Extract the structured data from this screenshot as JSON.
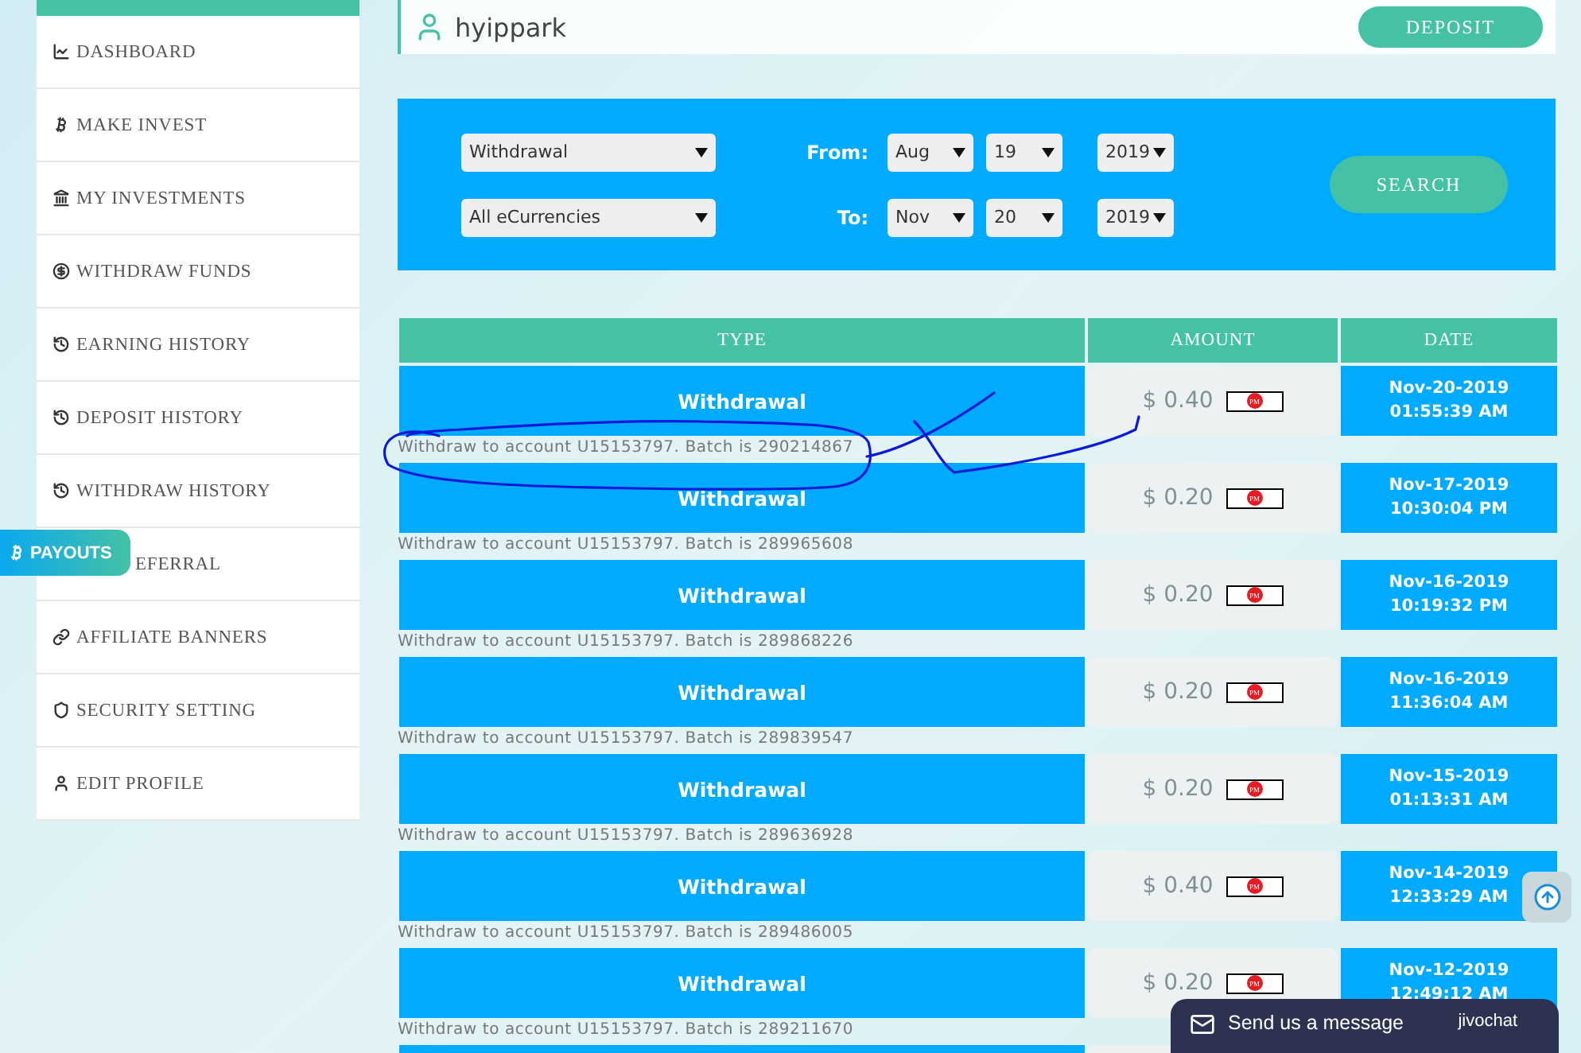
{
  "header": {
    "username": "hyippark",
    "button": "DEPOSIT"
  },
  "sidebar": {
    "items": [
      {
        "label": "DASHBOARD"
      },
      {
        "label": "MAKE INVEST"
      },
      {
        "label": "MY INVESTMENTS"
      },
      {
        "label": "WITHDRAW FUNDS"
      },
      {
        "label": "EARNING HISTORY"
      },
      {
        "label": "DEPOSIT HISTORY"
      },
      {
        "label": "WITHDRAW HISTORY"
      },
      {
        "label": "EFERRAL"
      },
      {
        "label": "AFFILIATE BANNERS"
      },
      {
        "label": "SECURITY SETTING"
      },
      {
        "label": "EDIT PROFILE"
      }
    ]
  },
  "payouts_tab": {
    "label": "PAYOUTS"
  },
  "filter": {
    "type_select": "Withdrawal",
    "currency_select": "All eCurrencies",
    "from_label": "From:",
    "to_label": "To:",
    "from": [
      "Aug",
      "19",
      "2019"
    ],
    "to": [
      "Nov",
      "20",
      "2019"
    ],
    "search_button": "SEARCH"
  },
  "table": {
    "columns": [
      "TYPE",
      "AMOUNT",
      "DATE"
    ],
    "rows": [
      {
        "type": "Withdrawal",
        "amount": "$ 0.40",
        "processor": "PM",
        "date": "Nov-20-2019 01:55:39 AM",
        "note": "Withdraw to account U15153797. Batch is 290214867"
      },
      {
        "type": "Withdrawal",
        "amount": "$ 0.20",
        "processor": "PM",
        "date": "Nov-17-2019 10:30:04 PM",
        "note": "Withdraw to account U15153797. Batch is 289965608"
      },
      {
        "type": "Withdrawal",
        "amount": "$ 0.20",
        "processor": "PM",
        "date": "Nov-16-2019 10:19:32 PM",
        "note": "Withdraw to account U15153797. Batch is 289868226"
      },
      {
        "type": "Withdrawal",
        "amount": "$ 0.20",
        "processor": "PM",
        "date": "Nov-16-2019 11:36:04 AM",
        "note": "Withdraw to account U15153797. Batch is 289839547"
      },
      {
        "type": "Withdrawal",
        "amount": "$ 0.20",
        "processor": "PM",
        "date": "Nov-15-2019 01:13:31 AM",
        "note": "Withdraw to account U15153797. Batch is 289636928"
      },
      {
        "type": "Withdrawal",
        "amount": "$ 0.40",
        "processor": "PM",
        "date": "Nov-14-2019 12:33:29 AM",
        "note": "Withdraw to account U15153797. Batch is 289486005"
      },
      {
        "type": "Withdrawal",
        "amount": "$ 0.20",
        "processor": "PM",
        "date": "Nov-12-2019 12:49:12 AM",
        "note": "Withdraw to account U15153797. Batch is 289211670"
      }
    ]
  },
  "chat": {
    "label": "Send us a message",
    "brand": "jivochat"
  }
}
